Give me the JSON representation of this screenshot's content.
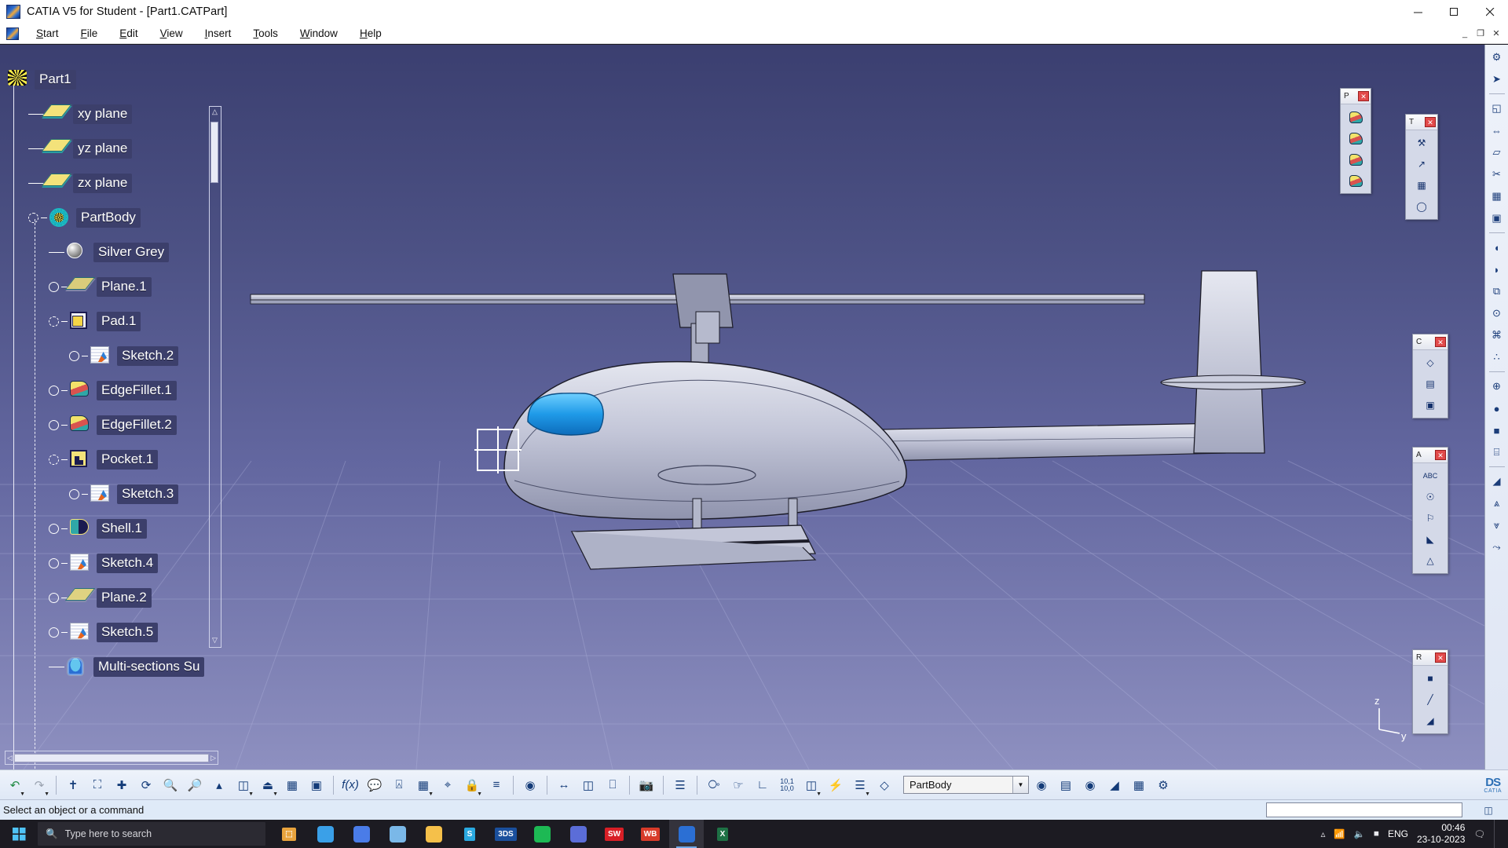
{
  "window": {
    "title": "CATIA V5 for Student - [Part1.CATPart]",
    "app_icon": "catia-logo-icon",
    "controls": {
      "minimize": "minimize-icon",
      "maximize": "maximize-icon",
      "close": "close-icon"
    },
    "mdi_controls": {
      "minimize": "_",
      "restore": "❐",
      "close": "✕"
    }
  },
  "menubar": {
    "items": [
      {
        "label": "Start",
        "mnemonic": "S"
      },
      {
        "label": "File",
        "mnemonic": "F"
      },
      {
        "label": "Edit",
        "mnemonic": "E"
      },
      {
        "label": "View",
        "mnemonic": "V"
      },
      {
        "label": "Insert",
        "mnemonic": "I"
      },
      {
        "label": "Tools",
        "mnemonic": "T"
      },
      {
        "label": "Window",
        "mnemonic": "W"
      },
      {
        "label": "Help",
        "mnemonic": "H"
      }
    ]
  },
  "tree": {
    "root": {
      "label": "Part1",
      "icon": "part-icon"
    },
    "items": [
      {
        "label": "xy plane",
        "icon": "plane-icon",
        "indent": 1,
        "handle": "none"
      },
      {
        "label": "yz plane",
        "icon": "plane-icon",
        "indent": 1,
        "handle": "none"
      },
      {
        "label": "zx plane",
        "icon": "plane-icon",
        "indent": 1,
        "handle": "none"
      },
      {
        "label": "PartBody",
        "icon": "body-icon",
        "indent": 1,
        "handle": "dashed"
      },
      {
        "label": "Silver Grey",
        "icon": "material-icon",
        "indent": 2,
        "handle": "none"
      },
      {
        "label": "Plane.1",
        "icon": "plane-ref-icon",
        "indent": 2,
        "handle": "circle"
      },
      {
        "label": "Pad.1",
        "icon": "pad-icon",
        "indent": 2,
        "handle": "dashed"
      },
      {
        "label": "Sketch.2",
        "icon": "sketch-icon",
        "indent": 3,
        "handle": "circle"
      },
      {
        "label": "EdgeFillet.1",
        "icon": "fillet-icon",
        "indent": 2,
        "handle": "circle"
      },
      {
        "label": "EdgeFillet.2",
        "icon": "fillet-icon",
        "indent": 2,
        "handle": "circle"
      },
      {
        "label": "Pocket.1",
        "icon": "pocket-icon",
        "indent": 2,
        "handle": "dashed"
      },
      {
        "label": "Sketch.3",
        "icon": "sketch-icon",
        "indent": 3,
        "handle": "circle"
      },
      {
        "label": "Shell.1",
        "icon": "shell-icon",
        "indent": 2,
        "handle": "circle"
      },
      {
        "label": "Sketch.4",
        "icon": "sketch-icon",
        "indent": 2,
        "handle": "circle"
      },
      {
        "label": "Plane.2",
        "icon": "plane-ref-icon",
        "indent": 2,
        "handle": "circle"
      },
      {
        "label": "Sketch.5",
        "icon": "sketch-icon",
        "indent": 2,
        "handle": "circle"
      },
      {
        "label": "Multi-sections Su",
        "icon": "multisection-icon",
        "indent": 2,
        "handle": "none"
      }
    ]
  },
  "viewport": {
    "model": "helicopter-3d-model",
    "background_top": "#3b3f70",
    "background_bottom": "#8e90c0",
    "body_color": "#b9bdd0",
    "canopy_color": "#1f9ae8",
    "axis": {
      "z": "z",
      "y": "y"
    }
  },
  "floating_toolbars": [
    {
      "name": "part-design-toolbar",
      "title": "P",
      "buttons": [
        "pad-icon",
        "pocket-icon",
        "shaft-icon",
        "groove-icon"
      ]
    },
    {
      "name": "tools-toolbar",
      "title": "T",
      "buttons": [
        "update-icon",
        "axis-icon",
        "grid-icon",
        "snap-icon"
      ]
    },
    {
      "name": "constraints-toolbar",
      "title": "C",
      "buttons": [
        "constraint-icon",
        "table-icon",
        "window-icon"
      ]
    },
    {
      "name": "annotations-toolbar",
      "title": "A",
      "buttons": [
        "abc-icon",
        "balloon-icon",
        "flag-icon",
        "weld-icon",
        "datum-icon"
      ]
    },
    {
      "name": "render-toolbar",
      "title": "R",
      "buttons": [
        "point-icon",
        "line-icon",
        "surface-icon"
      ]
    }
  ],
  "right_toolbar": {
    "buttons": [
      "gear-icon",
      "cursor-icon",
      "sketch-icon",
      "measure-icon",
      "plane-icon",
      "cut-icon",
      "pad-icon",
      "pocket-icon",
      "fillet-icon",
      "shell-icon",
      "draft-icon",
      "thread-icon",
      "mirror-icon",
      "pattern-icon",
      "scale-icon",
      "sphere-icon",
      "box-icon",
      "cylinder-icon",
      "surface-icon",
      "join-icon",
      "split-icon",
      "extrapolate-icon"
    ]
  },
  "bottom_toolbar": {
    "groups": [
      {
        "name": "undo-redo",
        "buttons": [
          "undo-icon",
          "redo-icon"
        ]
      },
      {
        "name": "view-tools",
        "buttons": [
          "fly-icon",
          "fit-all-icon",
          "pan-icon",
          "rotate-icon",
          "zoom-in-icon",
          "zoom-out-icon",
          "normal-view-icon",
          "isometric-view-icon",
          "cylinder-view-icon",
          "shading-icon",
          "shading-edges-icon"
        ]
      },
      {
        "name": "knowledge",
        "buttons": [
          "formula-icon",
          "comment-icon",
          "analysis-icon",
          "table-icon",
          "graph-icon"
        ]
      },
      {
        "name": "constraints",
        "buttons": [
          "lock-icon",
          "equal-icon"
        ]
      },
      {
        "name": "apply-material",
        "buttons": [
          "material-icon"
        ]
      },
      {
        "name": "measure",
        "buttons": [
          "measure-between-icon",
          "measure-item-icon",
          "measure-inertia-icon"
        ]
      },
      {
        "name": "capture",
        "buttons": [
          "camera-icon"
        ]
      },
      {
        "name": "analysis",
        "buttons": [
          "draft-analysis-icon"
        ]
      },
      {
        "name": "transform",
        "buttons": [
          "spiral-icon",
          "hand-spiral-icon",
          "axis-system-icon",
          "coordinates-icon",
          "solid-combine-icon",
          "power-copy-icon",
          "list-icon",
          "stack-icon"
        ]
      }
    ],
    "selected_body": "PartBody",
    "dropdown_icon": "chevron-down-icon",
    "brand": {
      "letters": "DS",
      "name": "CATIA"
    }
  },
  "statusbar": {
    "message": "Select an object or a command",
    "input_value": "",
    "icons": [
      "window-state-icon",
      "resize-grip-icon"
    ]
  },
  "taskbar": {
    "start": "windows-start-icon",
    "search_placeholder": "Type here to search",
    "search_icon": "search-icon",
    "apps": [
      {
        "name": "task-view-icon",
        "glyph": "⬚",
        "color": "#e8a33d",
        "active": false
      },
      {
        "name": "edge-browser-icon",
        "glyph": "",
        "color": "#3aa0e8",
        "active": false
      },
      {
        "name": "code-editor-icon",
        "glyph": "",
        "color": "#4a7ce8",
        "active": false
      },
      {
        "name": "gem-app-icon",
        "glyph": "",
        "color": "#7ab8e8",
        "active": false
      },
      {
        "name": "file-explorer-icon",
        "glyph": "",
        "color": "#f5c04a",
        "active": false
      },
      {
        "name": "skype-icon",
        "glyph": "S",
        "color": "#2aa9e0",
        "active": false
      },
      {
        "name": "3ds-icon",
        "glyph": "3DS",
        "color": "#1a4f9c",
        "active": false
      },
      {
        "name": "spotify-icon",
        "glyph": "",
        "color": "#1db954",
        "active": false
      },
      {
        "name": "teams-icon",
        "glyph": "",
        "color": "#5b6dd8",
        "active": false
      },
      {
        "name": "solidworks-icon",
        "glyph": "SW",
        "color": "#d81f26",
        "active": false
      },
      {
        "name": "whiteboard-icon",
        "glyph": "WB",
        "color": "#d83b2a",
        "active": false
      },
      {
        "name": "catia-icon",
        "glyph": "",
        "color": "#2b6fd4",
        "active": true
      },
      {
        "name": "excel-icon",
        "glyph": "X",
        "color": "#1e7145",
        "active": false
      }
    ],
    "tray": {
      "chevron": "show-hidden-icons-icon",
      "network": "wifi-icon",
      "volume": "speaker-icon",
      "battery": "battery-icon",
      "language": "ENG",
      "time": "00:46",
      "date": "23-10-2023",
      "notifications": "notification-center-icon"
    }
  }
}
